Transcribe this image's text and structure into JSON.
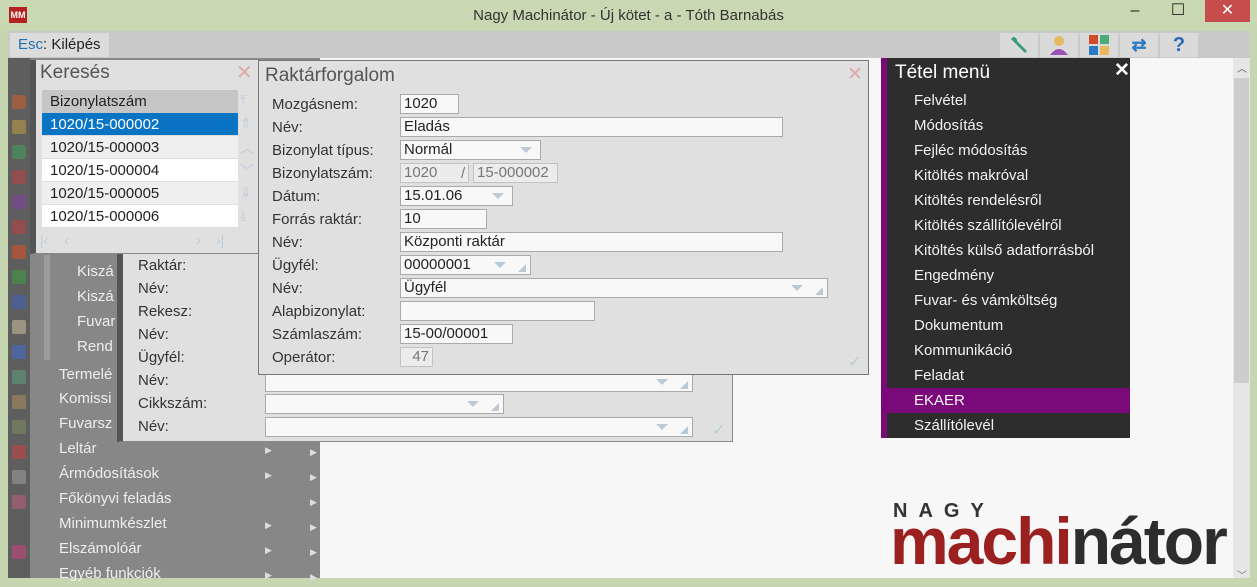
{
  "window": {
    "title": "Nagy Machinátor - Új kötet - a - Tóth Barnabás",
    "minimize": "–",
    "maximize": "☐",
    "close": "✕"
  },
  "toolbar": {
    "esc_key": "Esc",
    "esc_label": ": Kilépés",
    "icons": [
      "wrench-icon",
      "user-icon",
      "tiles-icon",
      "swap-icon",
      "help-icon"
    ],
    "help": "?",
    "swap": "⇄"
  },
  "left_menu": {
    "subitems": [
      "Kiszá",
      "Kiszá",
      "Fuvar",
      "Rend"
    ],
    "items": [
      "Termelé",
      "Komissi",
      "Fuvarsz",
      "Leltár",
      "Ármódosítások",
      "Főkönyvi feladás",
      "Minimumkészlet",
      "Elszámolóár",
      "Egyéb funkciók"
    ]
  },
  "back_dialog": {
    "labels": [
      "Raktár:",
      "Név:",
      "Rekesz:",
      "Név:",
      "Ügyfél:",
      "Név:",
      "Cikkszám:",
      "Név:"
    ]
  },
  "search": {
    "title": "Keresés",
    "column": "Bizonylatszám",
    "rows": [
      "1020/15-000002",
      "1020/15-000003",
      "1020/15-000004",
      "1020/15-000005",
      "1020/15-000006"
    ],
    "selected_index": 0
  },
  "form": {
    "title": "Raktárforgalom",
    "labels": [
      "Mozgásnem:",
      "Név:",
      "Bizonylat típus:",
      "Bizonylatszám:",
      "Dátum:",
      "Forrás raktár:",
      "Név:",
      "Ügyfél:",
      "Név:",
      "Alapbizonylat:",
      "Számlaszám:",
      "Operátor:"
    ],
    "mozgasnem": "1020",
    "nev": "Eladás",
    "bizonylat_tipus": "Normál",
    "bizonylatszam_prefix": "1020",
    "separator": "/",
    "bizonylatszam": "15-000002",
    "datum": "15.01.06",
    "forras_raktar": "10",
    "raktar_nev": "Központi raktár",
    "ugyfel": "00000001",
    "ugyfel_nev": "Ügyfél",
    "alapbizonylat": "",
    "szamlaszam": "15-00/00001",
    "operator": "47"
  },
  "item_menu": {
    "title": "Tétel menü",
    "close": "✕",
    "items": [
      "Felvétel",
      "Módosítás",
      "Fejléc módosítás",
      "Kitöltés makróval",
      "Kitöltés rendelésről",
      "Kitöltés szállítólevélről",
      "Kitöltés külső adatforrásból",
      "Engedmény",
      "Fuvar- és vámköltség",
      "Dokumentum",
      "Kommunikáció",
      "Feladat",
      "EKAER",
      "Szállítólevél"
    ],
    "active": "EKAER"
  },
  "logo": {
    "top": "NAGY",
    "red": "machi",
    "dark": "nátor"
  },
  "colors": {
    "accent": "#7a0a7a",
    "selection": "#0a74c4",
    "logo_red": "#9b2020"
  }
}
